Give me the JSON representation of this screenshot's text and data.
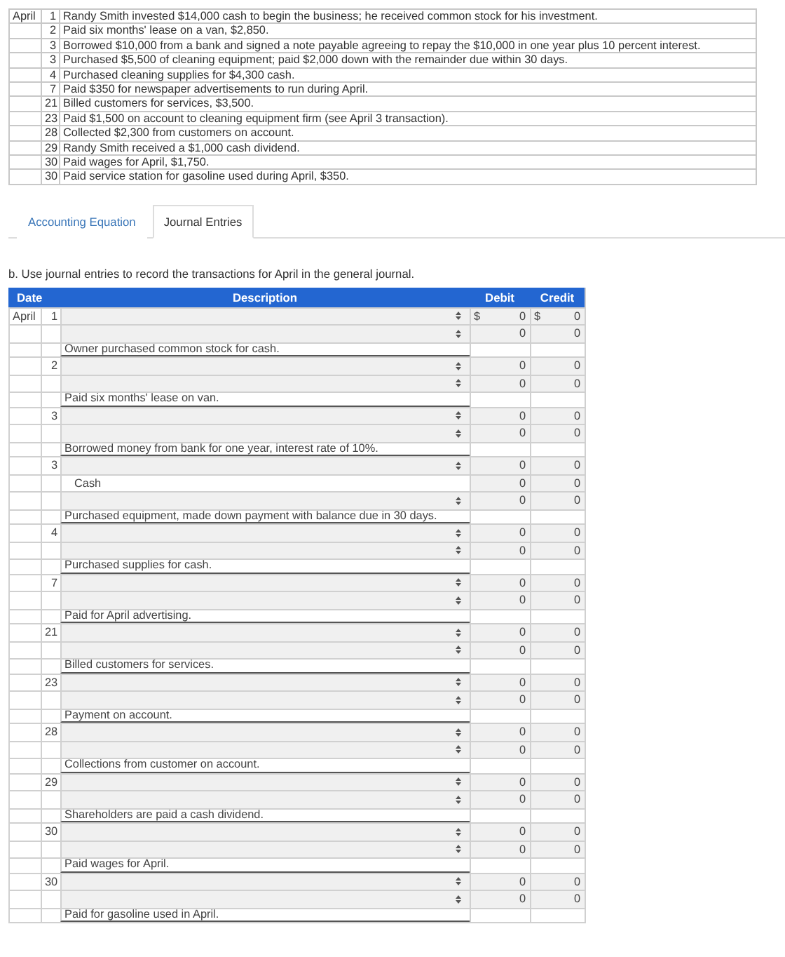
{
  "transactions": [
    {
      "month": "April",
      "day": "1",
      "text": "Randy Smith invested $14,000 cash to begin the business; he received common stock for his investment."
    },
    {
      "day": "2",
      "text": "Paid six months' lease on a van, $2,850."
    },
    {
      "day": "3",
      "text": "Borrowed $10,000 from a bank and signed a note payable agreeing to repay the $10,000 in one year plus 10 percent interest."
    },
    {
      "day": "3",
      "text": "Purchased $5,500 of cleaning equipment; paid $2,000 down with the remainder due within 30 days."
    },
    {
      "day": "4",
      "text": "Purchased cleaning supplies for $4,300 cash."
    },
    {
      "day": "7",
      "text": "Paid $350 for newspaper advertisements to run during April."
    },
    {
      "day": "21",
      "text": "Billed customers for services, $3,500."
    },
    {
      "day": "23",
      "text": "Paid $1,500 on account to cleaning equipment firm (see April 3 transaction)."
    },
    {
      "day": "28",
      "text": "Collected $2,300 from customers on account."
    },
    {
      "day": "29",
      "text": "Randy Smith received a $1,000 cash dividend."
    },
    {
      "day": "30",
      "text": "Paid wages for April, $1,750."
    },
    {
      "day": "30",
      "text": "Paid service station for gasoline used during April, $350."
    }
  ],
  "tabs": [
    {
      "label": "Accounting Equation",
      "selected": false
    },
    {
      "label": "Journal Entries",
      "selected": true
    }
  ],
  "instruction": "b. Use journal entries to record the transactions for April in the general journal.",
  "journal": {
    "columns": {
      "date": "Date",
      "description": "Description",
      "debit": "Debit",
      "credit": "Credit"
    },
    "entries": [
      {
        "month": "April",
        "day": "1",
        "lines": [
          {
            "kind": "select",
            "debit_prefix": "$",
            "debit": "0",
            "credit_prefix": "$",
            "credit": "0"
          },
          {
            "kind": "select",
            "debit": "0",
            "credit": "0"
          }
        ],
        "memo": "Owner purchased common stock for cash."
      },
      {
        "day": "2",
        "lines": [
          {
            "kind": "select",
            "debit": "0",
            "credit": "0"
          },
          {
            "kind": "select",
            "debit": "0",
            "credit": "0"
          }
        ],
        "memo": "Paid six months' lease on van."
      },
      {
        "day": "3",
        "lines": [
          {
            "kind": "select",
            "debit": "0",
            "credit": "0"
          },
          {
            "kind": "select",
            "debit": "0",
            "credit": "0"
          }
        ],
        "memo": "Borrowed money from bank for one year, interest rate of 10%."
      },
      {
        "day": "3",
        "lines": [
          {
            "kind": "select",
            "debit": "0",
            "credit": "0"
          },
          {
            "kind": "fixed",
            "account": "Cash",
            "debit": "0",
            "credit": "0"
          },
          {
            "kind": "select",
            "debit": "0",
            "credit": "0"
          }
        ],
        "memo": "Purchased equipment, made down payment with balance due in 30 days."
      },
      {
        "day": "4",
        "lines": [
          {
            "kind": "select",
            "debit": "0",
            "credit": "0"
          },
          {
            "kind": "select",
            "debit": "0",
            "credit": "0"
          }
        ],
        "memo": "Purchased supplies for cash."
      },
      {
        "day": "7",
        "lines": [
          {
            "kind": "select",
            "debit": "0",
            "credit": "0"
          },
          {
            "kind": "select",
            "debit": "0",
            "credit": "0"
          }
        ],
        "memo": "Paid for April advertising."
      },
      {
        "day": "21",
        "lines": [
          {
            "kind": "select",
            "debit": "0",
            "credit": "0"
          },
          {
            "kind": "select",
            "debit": "0",
            "credit": "0"
          }
        ],
        "memo": "Billed customers for services."
      },
      {
        "day": "23",
        "lines": [
          {
            "kind": "select",
            "debit": "0",
            "credit": "0"
          },
          {
            "kind": "select",
            "debit": "0",
            "credit": "0"
          }
        ],
        "memo": "Payment on account."
      },
      {
        "day": "28",
        "lines": [
          {
            "kind": "select",
            "debit": "0",
            "credit": "0"
          },
          {
            "kind": "select",
            "debit": "0",
            "credit": "0"
          }
        ],
        "memo": "Collections from customer on account."
      },
      {
        "day": "29",
        "lines": [
          {
            "kind": "select",
            "debit": "0",
            "credit": "0"
          },
          {
            "kind": "select",
            "debit": "0",
            "credit": "0"
          }
        ],
        "memo": "Shareholders are paid a cash dividend."
      },
      {
        "day": "30",
        "lines": [
          {
            "kind": "select",
            "debit": "0",
            "credit": "0"
          },
          {
            "kind": "select",
            "debit": "0",
            "credit": "0"
          }
        ],
        "memo": "Paid wages for April."
      },
      {
        "day": "30",
        "lines": [
          {
            "kind": "select",
            "debit": "0",
            "credit": "0"
          },
          {
            "kind": "select",
            "debit": "0",
            "credit": "0"
          }
        ],
        "memo": "Paid for gasoline used in April."
      }
    ]
  }
}
